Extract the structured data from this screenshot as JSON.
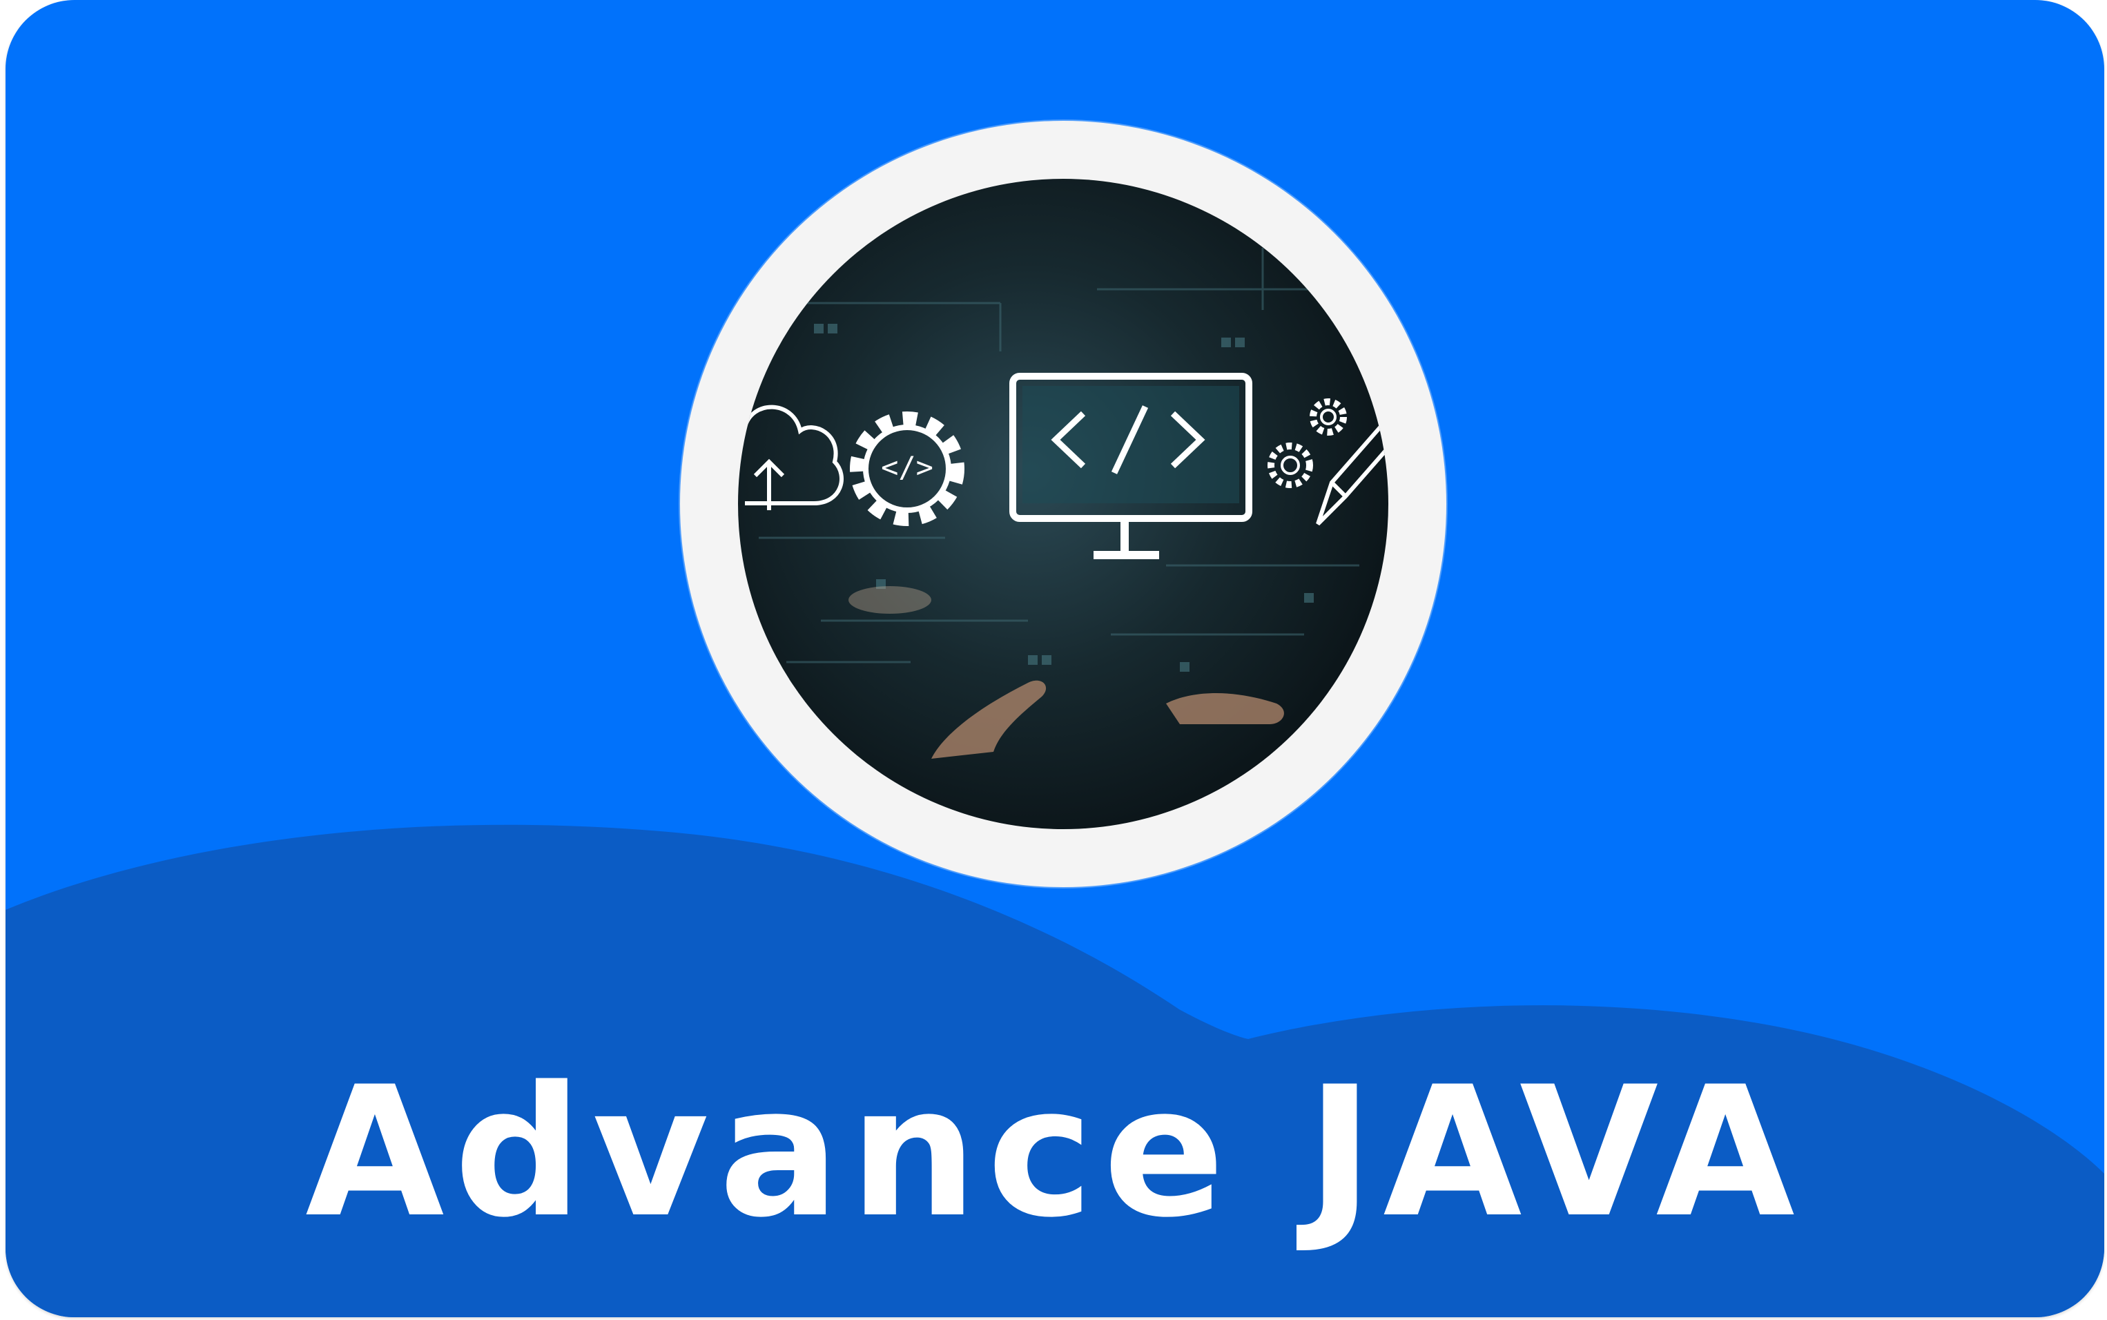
{
  "card": {
    "title": "Advance JAVA",
    "background_color": "#0172fb",
    "wave_color": "#0b5cc5",
    "ring_color": "#f4f4f4",
    "text_color": "#ffffff"
  },
  "illustration": {
    "icons": [
      "cloud-upload-icon",
      "code-gear-icon",
      "code-monitor-icon",
      "small-gear-icon",
      "pencil-icon"
    ],
    "code_glyph": "</>"
  }
}
